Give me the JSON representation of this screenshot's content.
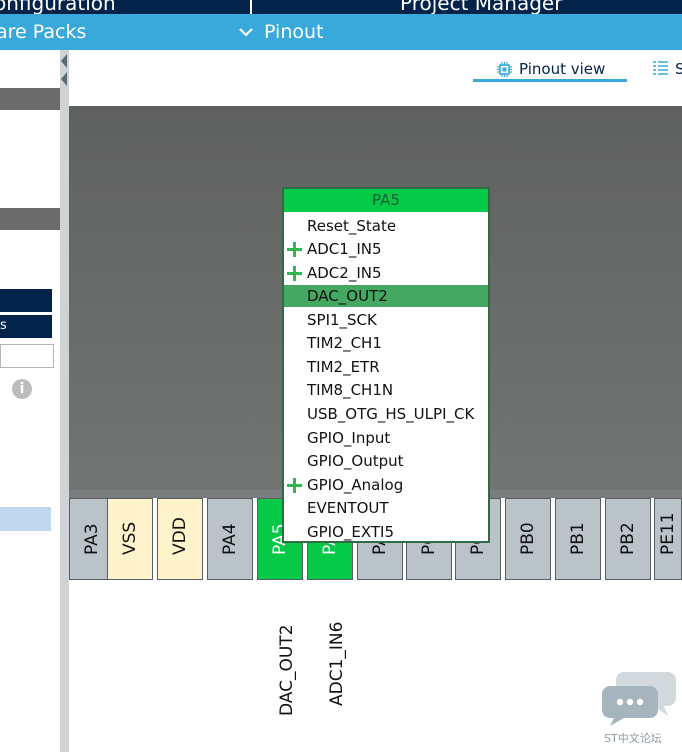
{
  "header": {
    "tab_left": "onfiguration",
    "tab_right": "Project Manager"
  },
  "subheader": {
    "left_label": "are Packs",
    "pinout_label": "Pinout",
    "pinout_chevron_icon": "chevron-down-icon"
  },
  "left_panel": {
    "navy_row_text": "s",
    "info_icon": "info-icon"
  },
  "view_tabs": {
    "pinout_view": "Pinout view",
    "pinout_view_icon": "chip-icon",
    "system_view": "S",
    "system_view_icon": "list-icon"
  },
  "popup": {
    "title": "PA5",
    "items": [
      {
        "label": "Reset_State",
        "plus": false,
        "selected": false
      },
      {
        "label": "ADC1_IN5",
        "plus": true,
        "selected": false
      },
      {
        "label": "ADC2_IN5",
        "plus": true,
        "selected": false
      },
      {
        "label": "DAC_OUT2",
        "plus": false,
        "selected": true
      },
      {
        "label": "SPI1_SCK",
        "plus": false,
        "selected": false
      },
      {
        "label": "TIM2_CH1",
        "plus": false,
        "selected": false
      },
      {
        "label": "TIM2_ETR",
        "plus": false,
        "selected": false
      },
      {
        "label": "TIM8_CH1N",
        "plus": false,
        "selected": false
      },
      {
        "label": "USB_OTG_HS_ULPI_CK",
        "plus": false,
        "selected": false
      },
      {
        "label": "GPIO_Input",
        "plus": false,
        "selected": false
      },
      {
        "label": "GPIO_Output",
        "plus": false,
        "selected": false
      },
      {
        "label": "GPIO_Analog",
        "plus": true,
        "selected": false
      },
      {
        "label": "EVENTOUT",
        "plus": false,
        "selected": false
      },
      {
        "label": "GPIO_EXTI5",
        "plus": false,
        "selected": false
      }
    ]
  },
  "pins": [
    {
      "label": "PA3",
      "type": "io"
    },
    {
      "label": "VSS",
      "type": "power"
    },
    {
      "label": "VDD",
      "type": "power"
    },
    {
      "label": "PA4",
      "type": "io"
    },
    {
      "label": "PA5",
      "type": "assigned"
    },
    {
      "label": "PA6",
      "type": "assigned"
    },
    {
      "label": "PA7",
      "type": "io"
    },
    {
      "label": "PC4",
      "type": "io"
    },
    {
      "label": "PC5",
      "type": "io"
    },
    {
      "label": "PB0",
      "type": "io"
    },
    {
      "label": "PB1",
      "type": "io"
    },
    {
      "label": "PB2",
      "type": "io"
    },
    {
      "label": "PE11",
      "type": "io"
    }
  ],
  "pin_signals": {
    "pa5": "DAC_OUT2",
    "pa6": "ADC1_IN6"
  },
  "watermark": {
    "text": "ST中文论坛",
    "icon": "chat-bubble-icon"
  },
  "colors": {
    "brand_navy": "#03234b",
    "brand_blue": "#39a9dc",
    "assigned_green": "#06c948",
    "selected_green": "#45a862"
  }
}
